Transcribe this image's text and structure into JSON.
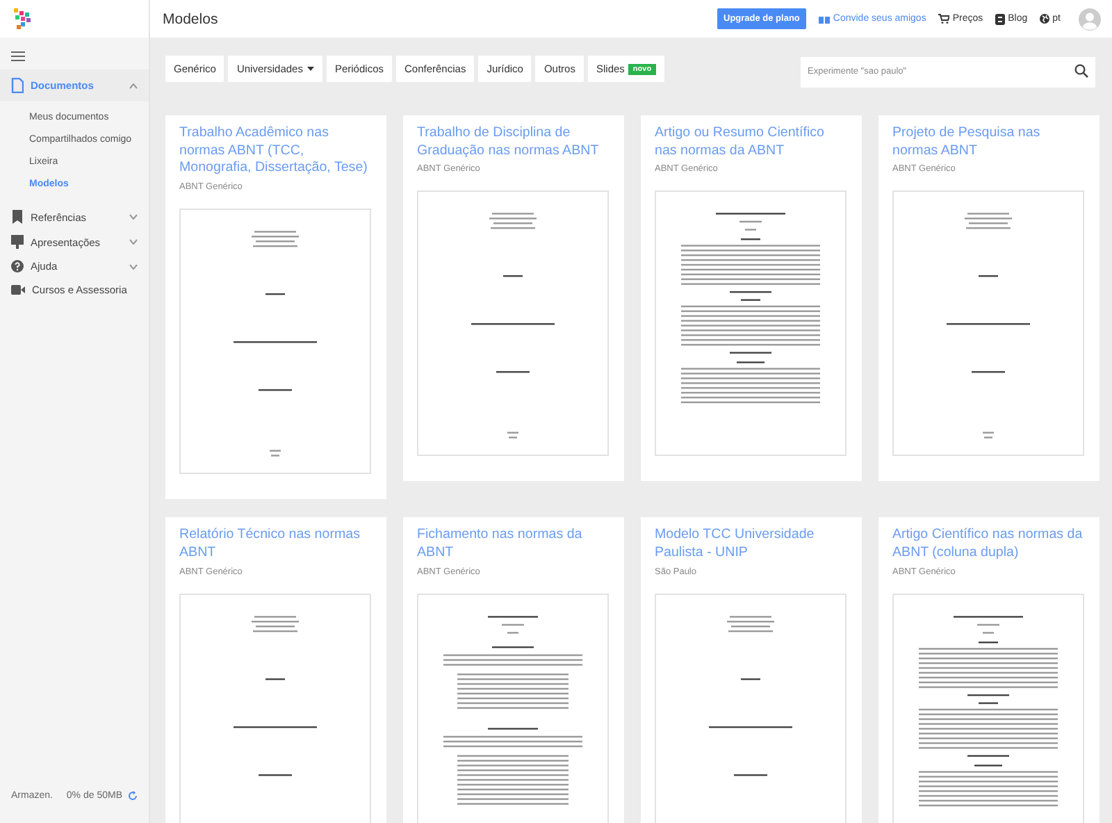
{
  "header": {
    "title": "Modelos",
    "upgrade_button": "Upgrade de plano",
    "links": [
      {
        "kind": "invite",
        "label": "Convide seus amigos"
      },
      {
        "kind": "cart",
        "label": "Preços"
      },
      {
        "kind": "blog",
        "label": "Blog"
      },
      {
        "kind": "globe",
        "label": "pt"
      }
    ]
  },
  "sidebar": {
    "sections": [
      {
        "kind": "doc",
        "label": "Documentos",
        "expanded": true,
        "selected": true,
        "children": [
          {
            "label": "Meus documentos",
            "selected": false
          },
          {
            "label": "Compartilhados comigo",
            "selected": false
          },
          {
            "label": "Lixeira",
            "selected": false
          },
          {
            "label": "Modelos",
            "selected": true
          }
        ]
      },
      {
        "kind": "bookmark",
        "label": "Referências",
        "expanded": false,
        "selected": false
      },
      {
        "kind": "slides",
        "label": "Apresentações",
        "expanded": false,
        "selected": false
      },
      {
        "kind": "help",
        "label": "Ajuda",
        "expanded": false,
        "selected": false
      },
      {
        "kind": "video",
        "label": "Cursos e Assessoria",
        "selected": false
      }
    ],
    "storage": {
      "label": "Armazen.",
      "usage": "0% de 50MB"
    }
  },
  "filters": [
    {
      "label": "Genérico",
      "dropdown": false
    },
    {
      "label": "Universidades",
      "dropdown": true
    },
    {
      "label": "Periódicos",
      "dropdown": false
    },
    {
      "label": "Conferências",
      "dropdown": false
    },
    {
      "label": "Jurídico",
      "dropdown": false
    },
    {
      "label": "Outros",
      "dropdown": false
    },
    {
      "label": "Slides",
      "dropdown": false,
      "badge": "novo"
    }
  ],
  "search": {
    "placeholder": "Experimente \"sao paulo\""
  },
  "cards": [
    {
      "title": "Trabalho Acadêmico nas normas ABNT (TCC, Monografia, Dissertação, Tese)",
      "category": "ABNT Genérico",
      "kind": "cover"
    },
    {
      "title": "Trabalho de Disciplina de Graduação nas normas ABNT",
      "category": "ABNT Genérico",
      "kind": "cover"
    },
    {
      "title": "Artigo ou Resumo Científico nas normas da ABNT",
      "category": "ABNT Genérico",
      "kind": "article"
    },
    {
      "title": "Projeto de Pesquisa nas normas ABNT",
      "category": "ABNT Genérico",
      "kind": "cover"
    },
    {
      "title": "Relatório Técnico nas normas ABNT",
      "category": "ABNT Genérico",
      "kind": "cover"
    },
    {
      "title": "Fichamento nas normas da ABNT",
      "category": "ABNT Genérico",
      "kind": "fichamento"
    },
    {
      "title": "Modelo TCC Universidade Paulista - UNIP",
      "category": "São Paulo",
      "kind": "cover"
    },
    {
      "title": "Artigo Científico nas normas da ABNT (coluna dupla)",
      "category": "ABNT Genérico",
      "kind": "article"
    }
  ]
}
